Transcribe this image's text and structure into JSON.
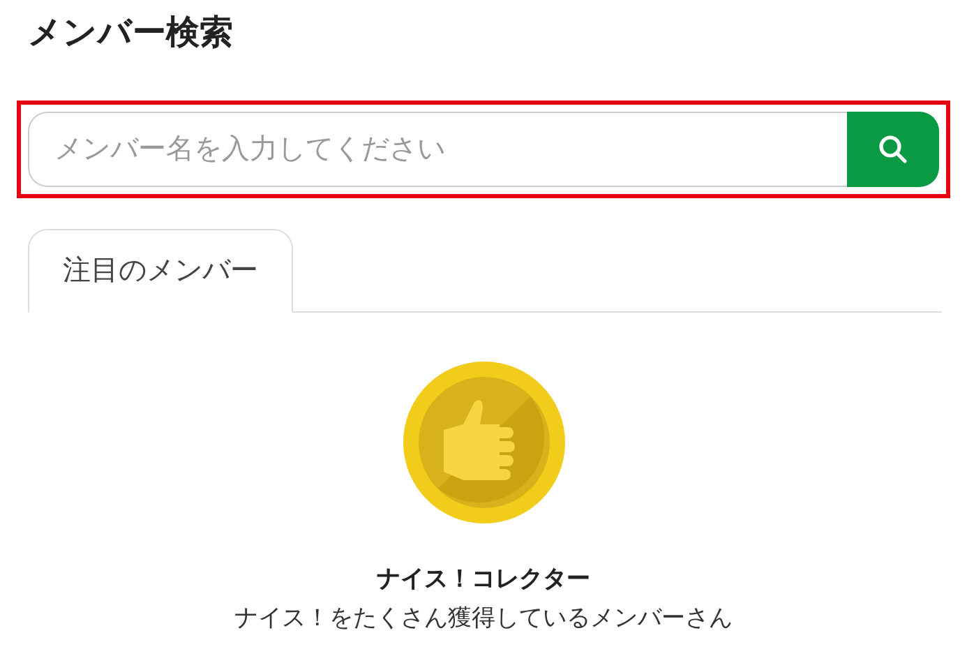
{
  "title": "メンバー検索",
  "search": {
    "placeholder": "メンバー名を入力してください",
    "highlighted": true
  },
  "tabs": [
    {
      "label": "注目のメンバー",
      "selected": true
    }
  ],
  "featured": {
    "name": "ナイス！コレクター",
    "description": "ナイス！をたくさん獲得しているメンバーさん"
  }
}
